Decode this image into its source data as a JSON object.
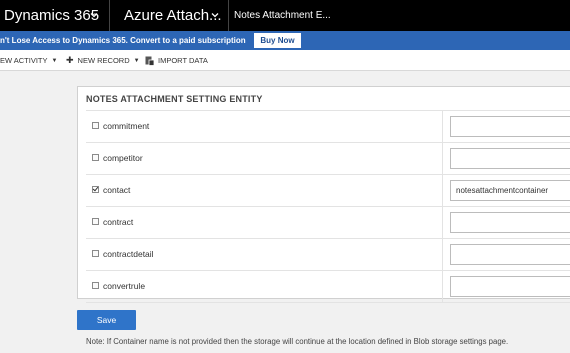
{
  "topbar": {
    "app_name": "Dynamics 365",
    "area_name": "Azure Attach...",
    "tab_title": "Notes Attachment E..."
  },
  "banner": {
    "message": "n't Lose Access to Dynamics 365. Convert to a paid subscription",
    "buy_label": "Buy Now"
  },
  "commands": {
    "new_activity": "EW ACTIVITY",
    "new_record": "NEW RECORD",
    "import_data": "IMPORT DATA"
  },
  "card": {
    "title": "NOTES ATTACHMENT SETTING ENTITY",
    "rows": [
      {
        "name": "commitment",
        "checked": false,
        "container": ""
      },
      {
        "name": "competitor",
        "checked": false,
        "container": ""
      },
      {
        "name": "contact",
        "checked": true,
        "container": "notesattachmentcontainer"
      },
      {
        "name": "contract",
        "checked": false,
        "container": ""
      },
      {
        "name": "contractdetail",
        "checked": false,
        "container": ""
      },
      {
        "name": "convertrule",
        "checked": false,
        "container": ""
      }
    ]
  },
  "save_label": "Save",
  "note": "Note: If Container name is not provided then the storage will continue at the location defined in Blob storage settings page.",
  "colors": {
    "topbar": "#000000",
    "banner": "#2d66b5",
    "primary_button": "#2f74c9"
  }
}
